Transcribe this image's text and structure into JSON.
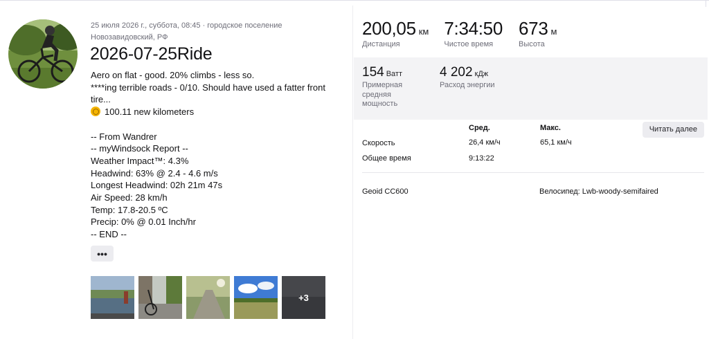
{
  "activity": {
    "meta_line1": "25 июля 2026 г., суббота, 08:45 · городское поселение",
    "meta_line2": "Новозавидовский, РФ",
    "title": "2026-07-25Ride",
    "description": [
      "Aero on flat - good. 20% climbs - less so.",
      "****ing terrible roads - 0/10. Should have used a fatter front",
      "tire..."
    ],
    "kudos_line": "100.11 new kilometers",
    "report": [
      "-- From Wandrer",
      "-- myWindsock Report --",
      "Weather Impact™: 4.3%",
      "Headwind: 63% @ 2.4 - 4.6 m/s",
      "Longest Headwind: 02h 21m 47s",
      "Air Speed: 28 km/h",
      "Temp: 17.8-20.5 ºC",
      "Precip: 0% @ 0.01 Inch/hr",
      "-- END --"
    ],
    "more_label": "•••",
    "photos_more": "+3"
  },
  "stats": {
    "distance": {
      "value": "200,05",
      "unit": "км",
      "label": "Дистанция"
    },
    "moving_time": {
      "value": "7:34:50",
      "unit": "",
      "label": "Чистое время"
    },
    "elevation": {
      "value": "673",
      "unit": "м",
      "label": "Высота"
    },
    "power": {
      "value": "154",
      "unit": "Ватт",
      "label_lines": [
        "Примерная",
        "средняя",
        "мощность"
      ]
    },
    "energy": {
      "value": "4 202",
      "unit": "кДж",
      "label": "Расход энергии"
    }
  },
  "table": {
    "col_avg": "Сред.",
    "col_max": "Макс.",
    "read_more": "Читать далее",
    "speed_label": "Скорость",
    "speed_avg": "26,4 км/ч",
    "speed_max": "65,1 км/ч",
    "elapsed_label": "Общее время",
    "elapsed_avg": "9:13:22",
    "device": "Geoid CC600",
    "bike": "Велосипед: Lwb-woody-semifaired"
  }
}
